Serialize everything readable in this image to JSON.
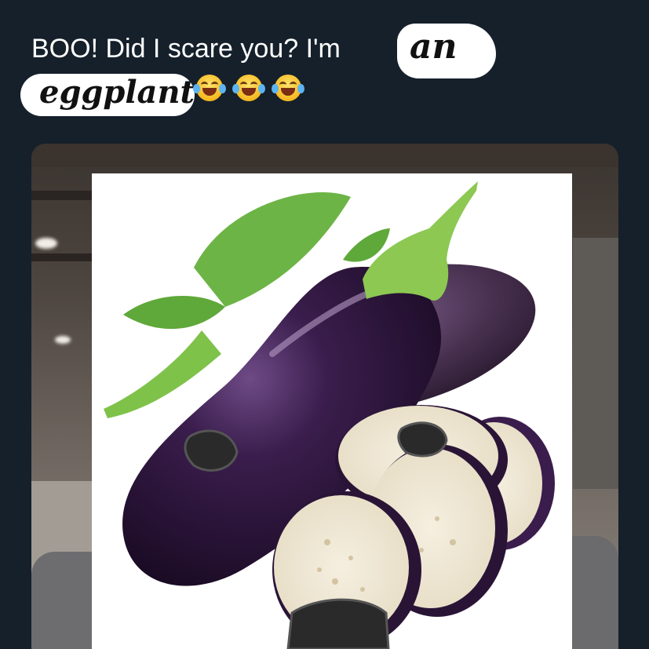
{
  "tweet": {
    "text_main": "BOO! Did I scare you?  I'm",
    "scrawl_an": "an",
    "scrawl_eggplant": "eggplant",
    "emoji_name": "face-with-tears-of-joy",
    "emoji_count": 3
  },
  "media": {
    "description_icon": "eggplant-image",
    "colors": {
      "background": "#15202b",
      "eggplant": "#2b1437",
      "stem": "#7fc24a",
      "leaf": "#5fa83a",
      "slice_flesh": "#f2ecdc"
    }
  }
}
